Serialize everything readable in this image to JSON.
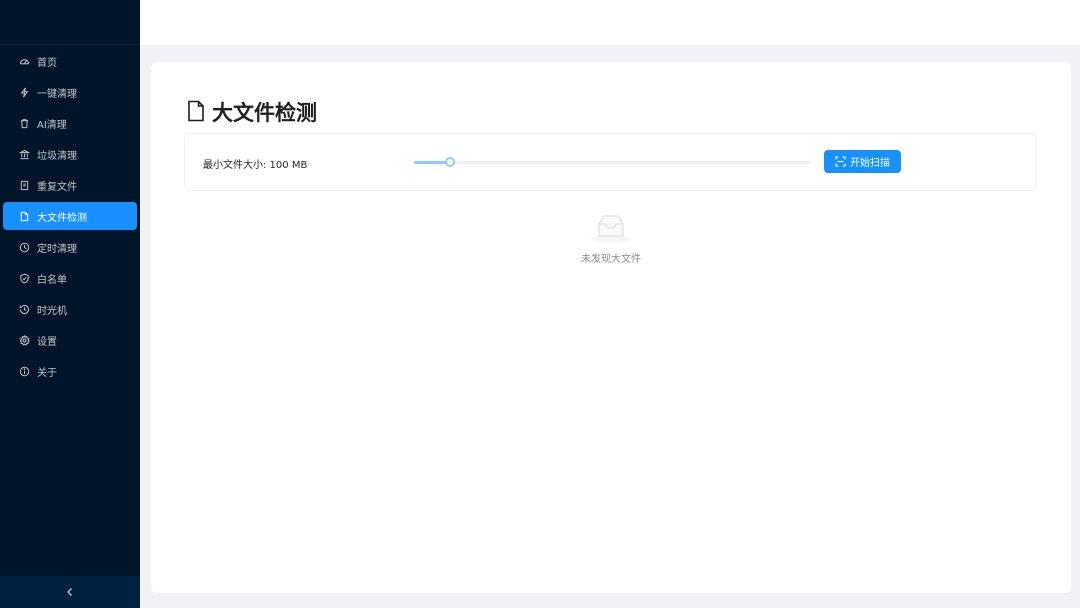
{
  "sidebar": {
    "items": [
      {
        "label": "首页",
        "icon": "dashboard-icon",
        "active": false
      },
      {
        "label": "一键清理",
        "icon": "thunderbolt-icon",
        "active": false
      },
      {
        "label": "AI清理",
        "icon": "trash-icon",
        "active": false
      },
      {
        "label": "垃圾清理",
        "icon": "bank-icon",
        "active": false
      },
      {
        "label": "重复文件",
        "icon": "copy-file-icon",
        "active": false
      },
      {
        "label": "大文件检测",
        "icon": "file-icon",
        "active": true
      },
      {
        "label": "定时清理",
        "icon": "clock-icon",
        "active": false
      },
      {
        "label": "白名单",
        "icon": "shield-icon",
        "active": false
      },
      {
        "label": "时光机",
        "icon": "history-icon",
        "active": false
      },
      {
        "label": "设置",
        "icon": "gear-icon",
        "active": false
      },
      {
        "label": "关于",
        "icon": "info-icon",
        "active": false
      }
    ],
    "collapse_icon": "chevron-left-icon"
  },
  "main": {
    "title": "大文件检测",
    "min_size_label": "最小文件大小: 100 MB",
    "slider_fraction": 0.09,
    "scan_button_label": "开始扫描",
    "empty_text": "未发现大文件"
  },
  "colors": {
    "sidebar_bg": "#001529",
    "accent": "#1890ff",
    "slider_color": "#91caff"
  }
}
